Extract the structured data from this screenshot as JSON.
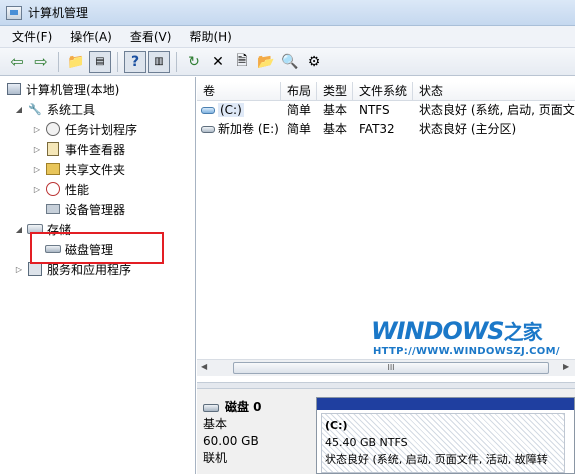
{
  "window": {
    "title": "计算机管理"
  },
  "menu": [
    "文件(F)",
    "操作(A)",
    "查看(V)",
    "帮助(H)"
  ],
  "toolbar": {
    "icons": [
      "back-arrow-icon",
      "forward-arrow-icon",
      "up-folder-icon",
      "show-tree-icon",
      "help-icon",
      "action-pane-icon",
      "refresh-icon",
      "delete-icon",
      "properties-icon",
      "open-icon",
      "search-icon",
      "settings-icon"
    ]
  },
  "tree": {
    "root": "计算机管理(本地)",
    "system_tools": "系统工具",
    "task_scheduler": "任务计划程序",
    "event_viewer": "事件查看器",
    "shared_folders": "共享文件夹",
    "performance": "性能",
    "device_manager": "设备管理器",
    "storage": "存储",
    "disk_management": "磁盘管理",
    "services": "服务和应用程序"
  },
  "volume_list": {
    "columns": [
      "卷",
      "布局",
      "类型",
      "文件系统",
      "状态"
    ],
    "rows": [
      {
        "volume": "(C:)",
        "layout": "简单",
        "type": "基本",
        "fs": "NTFS",
        "status": "状态良好 (系统, 启动, 页面文件"
      },
      {
        "volume": "新加卷 (E:)",
        "layout": "简单",
        "type": "基本",
        "fs": "FAT32",
        "status": "状态良好 (主分区)"
      }
    ]
  },
  "scroll": {
    "thumb_glyph": "III"
  },
  "disk": {
    "name": "磁盘 0",
    "kind": "基本",
    "size": "60.00 GB",
    "state": "联机",
    "partition": {
      "label": "(C:)",
      "detail": "45.40 GB NTFS",
      "status": "状态良好 (系统, 启动, 页面文件, 活动, 故障转"
    }
  },
  "watermark": {
    "logo": "WINDOWS",
    "logo_cn": "之家",
    "url": "HTTP://WWW.WINDOWSZJ.COM/"
  }
}
